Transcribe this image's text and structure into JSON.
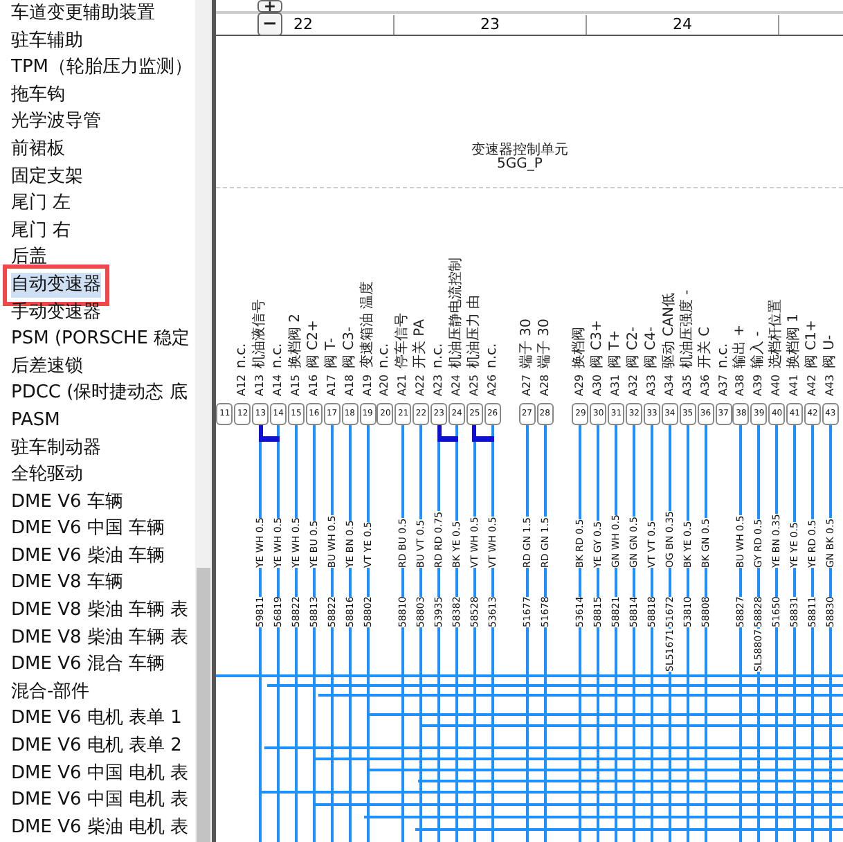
{
  "sidebar": {
    "items": [
      {
        "label": "车道变更辅助装置",
        "selected": false,
        "highlighted": false
      },
      {
        "label": "驻车辅助",
        "selected": false,
        "highlighted": false
      },
      {
        "label": "TPM（轮胎压力监测）",
        "selected": false,
        "highlighted": false
      },
      {
        "label": "拖车钩",
        "selected": false,
        "highlighted": false
      },
      {
        "label": "光学波导管",
        "selected": false,
        "highlighted": false
      },
      {
        "label": "前裙板",
        "selected": false,
        "highlighted": false
      },
      {
        "label": "固定支架",
        "selected": false,
        "highlighted": false
      },
      {
        "label": "尾门 左",
        "selected": false,
        "highlighted": false
      },
      {
        "label": "尾门 右",
        "selected": false,
        "highlighted": false
      },
      {
        "label": "后盖",
        "selected": false,
        "highlighted": false
      },
      {
        "label": "自动变速器",
        "selected": true,
        "highlighted": true
      },
      {
        "label": "手动变速器",
        "selected": false,
        "highlighted": false
      },
      {
        "label": "PSM (PORSCHE 稳定",
        "selected": false,
        "highlighted": false
      },
      {
        "label": "后差速锁",
        "selected": false,
        "highlighted": false
      },
      {
        "label": "PDCC (保时捷动态 底",
        "selected": false,
        "highlighted": false
      },
      {
        "label": "PASM",
        "selected": false,
        "highlighted": false
      },
      {
        "label": "驻车制动器",
        "selected": false,
        "highlighted": false
      },
      {
        "label": "全轮驱动",
        "selected": false,
        "highlighted": false
      },
      {
        "label": "DME V6 车辆",
        "selected": false,
        "highlighted": false
      },
      {
        "label": "DME V6 中国 车辆",
        "selected": false,
        "highlighted": false
      },
      {
        "label": "DME V6 柴油 车辆",
        "selected": false,
        "highlighted": false
      },
      {
        "label": "DME V8 车辆",
        "selected": false,
        "highlighted": false
      },
      {
        "label": "DME V8 柴油 车辆 表",
        "selected": false,
        "highlighted": false
      },
      {
        "label": "DME V8 柴油 车辆 表",
        "selected": false,
        "highlighted": false
      },
      {
        "label": "DME V6 混合 车辆",
        "selected": false,
        "highlighted": false
      },
      {
        "label": "混合-部件",
        "selected": false,
        "highlighted": false
      },
      {
        "label": "DME V6 电机 表单 1",
        "selected": false,
        "highlighted": false
      },
      {
        "label": "DME V6 电机 表单 2",
        "selected": false,
        "highlighted": false
      },
      {
        "label": "DME V6 中国 电机 表",
        "selected": false,
        "highlighted": false
      },
      {
        "label": "DME V6 中国 电机 表",
        "selected": false,
        "highlighted": false
      },
      {
        "label": "DME V6 柴油 电机 表",
        "selected": false,
        "highlighted": false
      }
    ]
  },
  "diagram": {
    "zoom_in": "+",
    "zoom_out": "−",
    "columns": [
      "22",
      "23",
      "24"
    ],
    "unit_title": "变速器控制单元",
    "unit_code": "5GG_P",
    "pin_groups": [
      [
        {
          "number": "11",
          "wired": false,
          "jumper": false
        },
        {
          "number": "12",
          "pin": "A12",
          "func": "n.c.",
          "wired": false,
          "jumper": false
        },
        {
          "number": "13",
          "pin": "A13",
          "func": "机油液信号",
          "wire": "YE WH 0.5",
          "code": "59811",
          "wired": true,
          "jumper": true
        },
        {
          "number": "14",
          "pin": "A14",
          "func": "n.c.",
          "wire": "YE WH 0.5",
          "code": "56819",
          "wired": true,
          "jumper": false
        },
        {
          "number": "15",
          "pin": "A15",
          "func": "换档阀 2",
          "wire": "YE WH 0.5",
          "code": "58822",
          "wired": true,
          "jumper": false
        },
        {
          "number": "16",
          "pin": "A16",
          "func": "阀 C2+",
          "wire": "YE BU 0.5",
          "code": "58813",
          "wired": true,
          "jumper": false
        },
        {
          "number": "17",
          "pin": "A17",
          "func": "阀 T-",
          "wire": "BU WH 0.5",
          "code": "58822",
          "wired": true,
          "jumper": false
        },
        {
          "number": "18",
          "pin": "A18",
          "func": "阀 C3-",
          "wire": "YE BN 0.5",
          "code": "58816",
          "wired": true,
          "jumper": false
        },
        {
          "number": "19",
          "pin": "A19",
          "func": "变速箱油 温度",
          "wire": "VT YE 0.5",
          "code": "58802",
          "wired": true,
          "jumper": false
        },
        {
          "number": "20",
          "pin": "A20",
          "func": "n.c.",
          "wired": false,
          "jumper": false
        },
        {
          "number": "21",
          "pin": "A21",
          "func": "停车信号",
          "wire": "RD BU 0.5",
          "code": "58810",
          "wired": true,
          "jumper": false
        },
        {
          "number": "22",
          "pin": "A22",
          "func": "开关 PA",
          "wire": "BU VT 0.5",
          "code": "58803",
          "wired": true,
          "jumper": false
        },
        {
          "number": "23",
          "pin": "A23",
          "func": "n.c.",
          "wire": "RD RD 0.75",
          "code": "53935",
          "wired": true,
          "jumper": true
        },
        {
          "number": "24",
          "pin": "A24",
          "func": "机油压静电流控制",
          "wire": "BK YE 0.5",
          "code": "58382",
          "wired": true,
          "jumper": false
        },
        {
          "number": "25",
          "pin": "A25",
          "func": "机油压力 由",
          "wire": "VT WH 0.5",
          "code": "58528",
          "wired": true,
          "jumper": true
        },
        {
          "number": "26",
          "pin": "A26",
          "func": "n.c.",
          "wire": "VT WH 0.5",
          "code": "53613",
          "wired": true,
          "jumper": false
        }
      ],
      [
        {
          "number": "27",
          "pin": "A27",
          "func": "端子 30",
          "wire": "RD GN 1.5",
          "code": "51677",
          "wired": true,
          "jumper": false
        },
        {
          "number": "28",
          "pin": "A28",
          "func": "端子 30",
          "wire": "RD GN 1.5",
          "code": "51678",
          "wired": true,
          "jumper": false
        }
      ],
      [
        {
          "number": "29",
          "pin": "A29",
          "func": "换档阀",
          "wire": "BK RD 0.5",
          "code": "53614",
          "wired": true,
          "jumper": false
        },
        {
          "number": "30",
          "pin": "A30",
          "func": "阀 C3+",
          "wire": "YE GY 0.5",
          "code": "58815",
          "wired": true,
          "jumper": false
        },
        {
          "number": "31",
          "pin": "A31",
          "func": "阀 T+",
          "wire": "GN WH 0.5",
          "code": "58821",
          "wired": true,
          "jumper": false
        },
        {
          "number": "32",
          "pin": "A32",
          "func": "阀 C2-",
          "wire": "GN GN 0.5",
          "code": "58814",
          "wired": true,
          "jumper": false
        },
        {
          "number": "33",
          "pin": "A33",
          "func": "阀 C4-",
          "wire": "VT VT 0.5",
          "code": "58818",
          "wired": true,
          "jumper": false
        },
        {
          "number": "34",
          "pin": "A34",
          "func": "驱动 CAN低",
          "wire": "OG BN 0.35",
          "code": "51672",
          "code2": "SL51671",
          "wired": true,
          "jumper": false
        },
        {
          "number": "35",
          "pin": "A35",
          "func": "机油压强度 -",
          "wire": "BK YE 0.5",
          "code": "53810",
          "wired": true,
          "jumper": false
        },
        {
          "number": "36",
          "pin": "A36",
          "func": "开关 C",
          "wire": "BK GN 0.5",
          "code": "58808",
          "wired": true,
          "jumper": false
        },
        {
          "number": "37",
          "pin": "A37",
          "func": "n.c.",
          "wired": false,
          "jumper": false
        },
        {
          "number": "38",
          "pin": "A38",
          "func": "输出 +",
          "wire": "BU WH 0.5",
          "code": "58827",
          "wired": true,
          "jumper": false
        },
        {
          "number": "39",
          "pin": "A39",
          "func": "输入 -",
          "wire": "GY RD 0.5",
          "code": "58828",
          "code2": "SL58807",
          "wired": true,
          "jumper": false
        },
        {
          "number": "40",
          "pin": "A40",
          "func": "选档杆位置",
          "wire": "YE BN 0.35",
          "code": "51650",
          "wired": true,
          "jumper": false
        },
        {
          "number": "41",
          "pin": "A41",
          "func": "换档阀 1",
          "wire": "YE YE 0.5",
          "code": "58831",
          "wired": true,
          "jumper": false
        },
        {
          "number": "42",
          "pin": "A42",
          "func": "阀 C1+",
          "wire": "YE RD 0.5",
          "code": "58811",
          "wired": true,
          "jumper": false
        },
        {
          "number": "43",
          "pin": "A43",
          "func": "阀 U-",
          "wire": "GN BK 0.5",
          "code": "58830",
          "wired": true,
          "jumper": false
        }
      ]
    ]
  }
}
